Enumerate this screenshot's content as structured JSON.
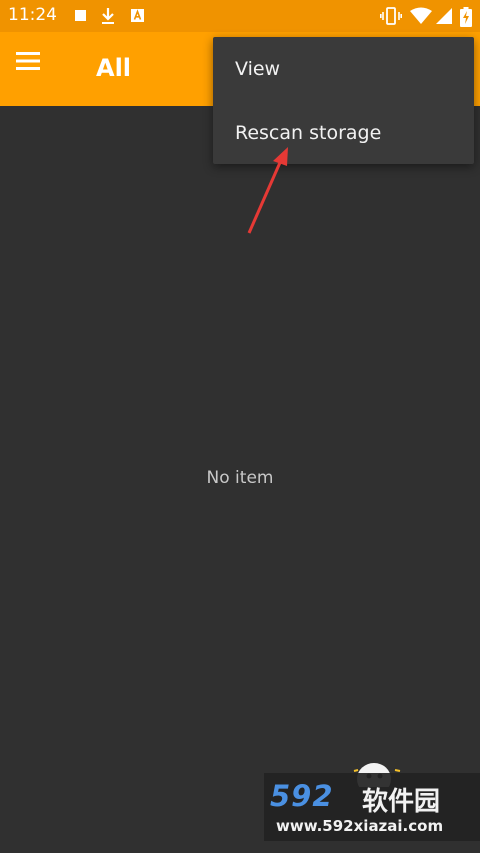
{
  "status_bar": {
    "time": "11:24",
    "left_icons": [
      "stop-icon",
      "download-icon",
      "font-icon"
    ],
    "right_icons": [
      "vibrate-icon",
      "wifi-icon",
      "signal-icon",
      "battery-charging-icon"
    ]
  },
  "app_bar": {
    "title": "All",
    "menu_icon": "hamburger-menu-icon",
    "color": "#ffa000"
  },
  "overflow_menu": {
    "items": [
      {
        "label": "View"
      },
      {
        "label": "Rescan storage"
      }
    ]
  },
  "content": {
    "empty_text": "No item"
  },
  "watermark": {
    "brand": "592",
    "name": "软件园",
    "url": "www.592xiazai.com"
  },
  "colors": {
    "accent": "#ffa000",
    "status_bar": "#f09300",
    "background": "#303030",
    "menu": "#3a3a3a",
    "arrow": "#e53935"
  }
}
